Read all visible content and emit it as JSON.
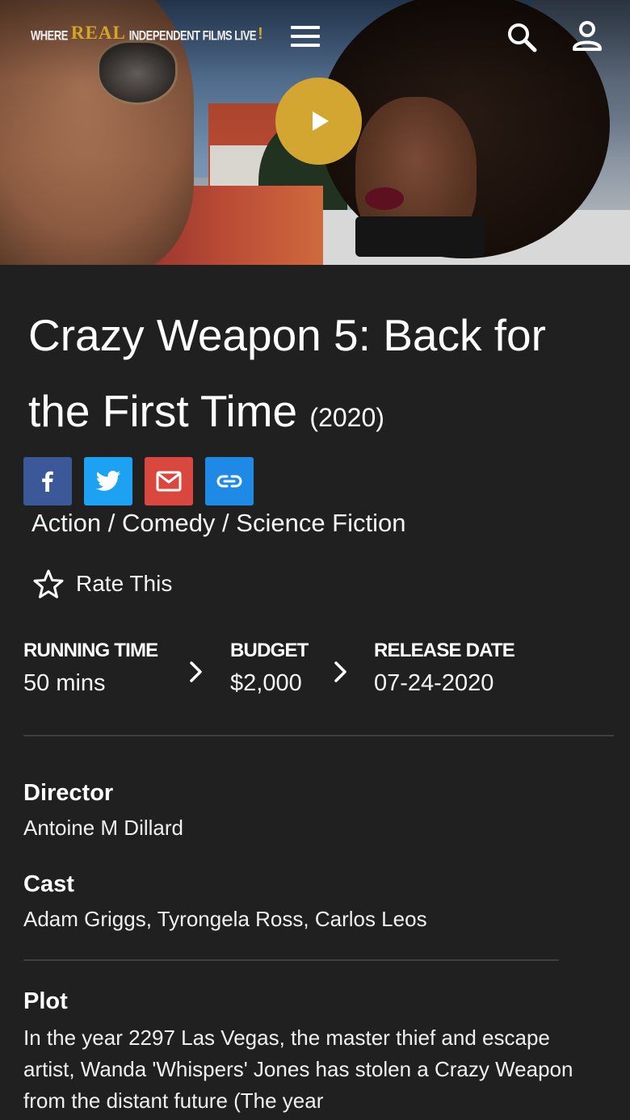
{
  "header": {
    "logo_where": "WHERE",
    "logo_real": "REAL",
    "logo_rest": "INDEPENDENT FILMS LIVE",
    "logo_bang": "!",
    "menu_icon": "hamburger-menu-icon",
    "search_icon": "search-icon",
    "account_icon": "user-account-icon"
  },
  "hero": {
    "play_icon": "play-icon",
    "play_color": "#d3a631"
  },
  "movie": {
    "title": "Crazy Weapon 5: Back for the First Time",
    "year": "(2020)",
    "genres": "Action / Comedy / Science Fiction",
    "rate_label": "Rate This"
  },
  "share": {
    "facebook_icon": "facebook-icon",
    "twitter_icon": "twitter-icon",
    "email_icon": "email-icon",
    "link_icon": "link-icon",
    "facebook_color": "#3b5998",
    "twitter_color": "#1da1f2",
    "email_color": "#d9473f",
    "link_color": "#1e8ae6"
  },
  "stats": {
    "running_time_label": "RUNNING TIME",
    "running_time_value": "50 mins",
    "budget_label": "BUDGET",
    "budget_value": "$2,000",
    "release_label": "RELEASE DATE",
    "release_value": "07-24-2020"
  },
  "details": {
    "director_label": "Director",
    "director_value": "Antoine M Dillard",
    "cast_label": "Cast",
    "cast": [
      "Adam Griggs,",
      "Tyrongela Ross,",
      "Carlos Leos"
    ],
    "plot_label": "Plot",
    "plot_value": "In the year 2297 Las Vegas, the master thief and escape artist, Wanda 'Whispers' Jones has stolen a Crazy Weapon from the distant future (The year"
  }
}
